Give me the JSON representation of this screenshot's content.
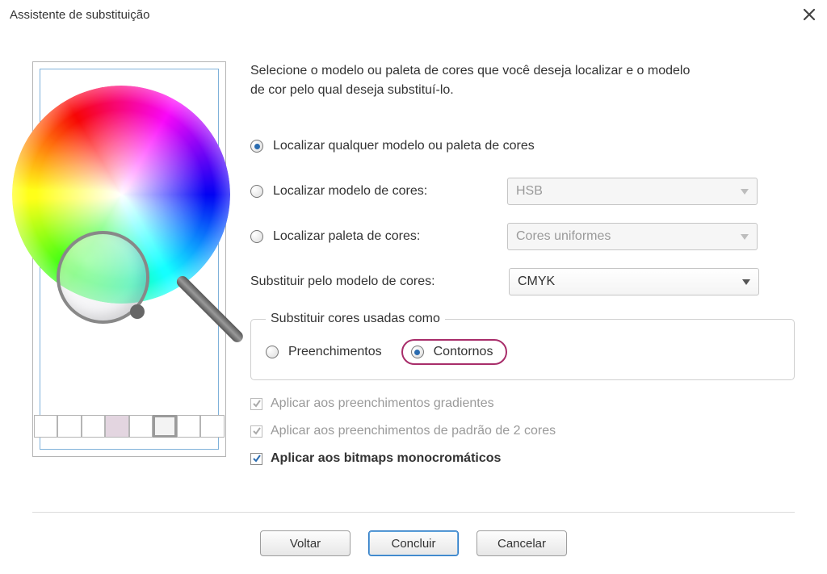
{
  "dialog": {
    "title": "Assistente de substituição"
  },
  "instructions": "Selecione o modelo ou paleta de cores que você deseja localizar e o modelo de cor pelo qual deseja substituí-lo.",
  "options": {
    "find_any": {
      "label": "Localizar qualquer modelo ou paleta de cores",
      "checked": true
    },
    "find_model": {
      "label": "Localizar modelo de cores:",
      "checked": false
    },
    "find_palette": {
      "label": "Localizar paleta de cores:",
      "checked": false
    },
    "replace_with_label": "Substituir pelo modelo de cores:"
  },
  "selects": {
    "model": {
      "value": "HSB",
      "enabled": false
    },
    "palette": {
      "value": "Cores uniformes",
      "enabled": false
    },
    "replace": {
      "value": "CMYK",
      "enabled": true
    }
  },
  "usage_group": {
    "legend": "Substituir cores usadas como",
    "fills": {
      "label": "Preenchimentos",
      "checked": false
    },
    "outlines": {
      "label": "Contornos",
      "checked": true
    }
  },
  "checks": {
    "gradient_fills": {
      "label": "Aplicar aos preenchimentos gradientes",
      "checked": true,
      "enabled": false
    },
    "two_color_pattern": {
      "label": "Aplicar aos preenchimentos de padrão de 2 cores",
      "checked": true,
      "enabled": false
    },
    "mono_bitmaps": {
      "label": "Aplicar aos bitmaps monocromáticos",
      "checked": true,
      "enabled": true
    }
  },
  "buttons": {
    "back": "Voltar",
    "finish": "Concluir",
    "cancel": "Cancelar"
  }
}
